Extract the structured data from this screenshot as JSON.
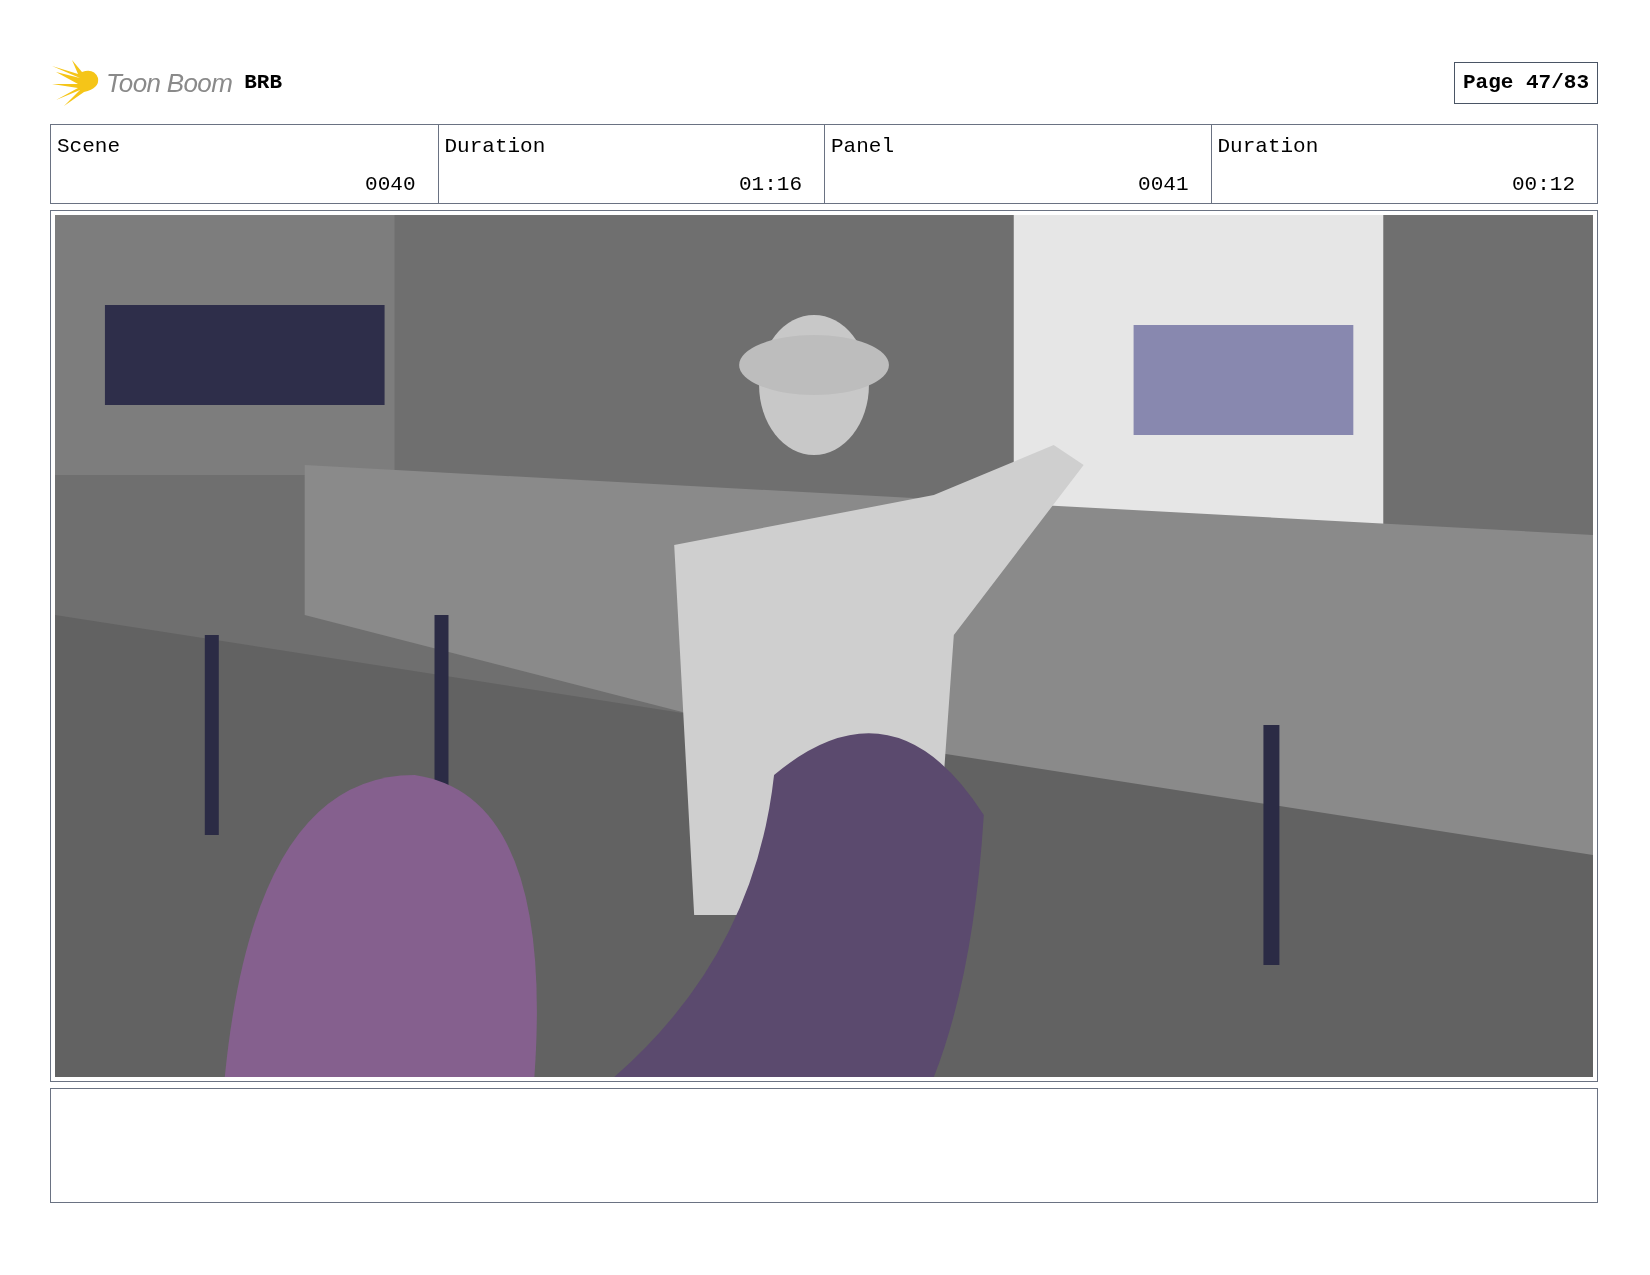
{
  "header": {
    "logo_text": "Toon Boom",
    "project": "BRB",
    "page": "Page 47/83"
  },
  "fields": [
    {
      "label": "Scene",
      "value": "0040"
    },
    {
      "label": "Duration",
      "value": "01:16"
    },
    {
      "label": "Panel",
      "value": "0041"
    },
    {
      "label": "Duration",
      "value": "00:12"
    }
  ]
}
